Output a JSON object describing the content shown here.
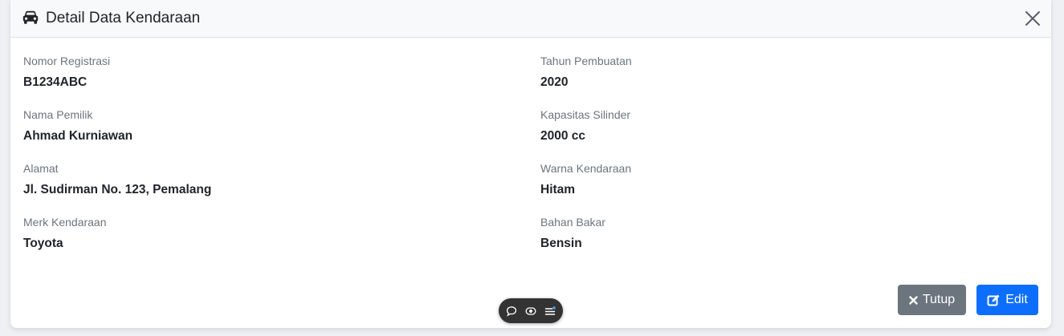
{
  "modal": {
    "title": "Detail Data Kendaraan",
    "title_icon": "car-icon",
    "close_icon": "close-icon"
  },
  "fields": {
    "nomor_registrasi": {
      "label": "Nomor Registrasi",
      "value": "B1234ABC"
    },
    "nama_pemilik": {
      "label": "Nama Pemilik",
      "value": "Ahmad Kurniawan"
    },
    "alamat": {
      "label": "Alamat",
      "value": "Jl. Sudirman No. 123, Pemalang"
    },
    "merk_kendaraan": {
      "label": "Merk Kendaraan",
      "value": "Toyota"
    },
    "tahun_pembuatan": {
      "label": "Tahun Pembuatan",
      "value": "2020"
    },
    "kapasitas_silinder": {
      "label": "Kapasitas Silinder",
      "value": "2000 cc"
    },
    "warna_kendaraan": {
      "label": "Warna Kendaraan",
      "value": "Hitam"
    },
    "bahan_bakar": {
      "label": "Bahan Bakar",
      "value": "Bensin"
    }
  },
  "footer": {
    "close_label": "Tutup",
    "close_icon": "times-icon",
    "edit_label": "Edit",
    "edit_icon": "edit-icon"
  },
  "floating_toolbar": {
    "icons": [
      "comment-icon",
      "eye-icon",
      "list-icon"
    ]
  },
  "colors": {
    "secondary": "#6c757d",
    "primary": "#0d6efd",
    "header_bg": "#f8f9fa",
    "toolbar_bg": "#333333"
  }
}
